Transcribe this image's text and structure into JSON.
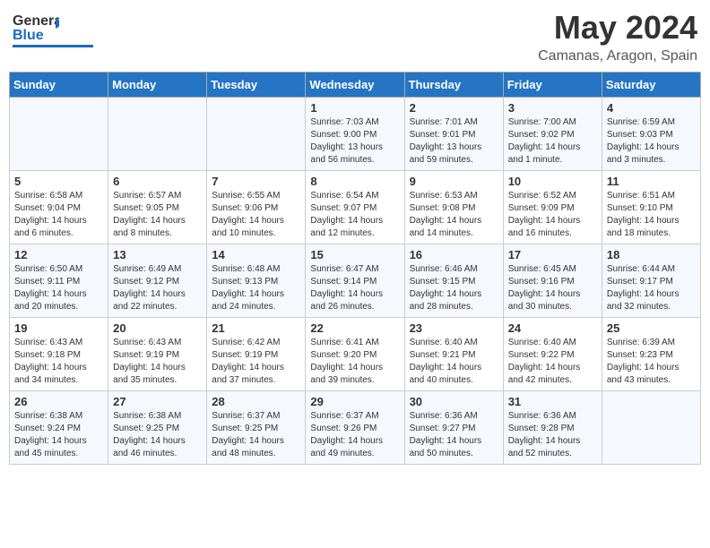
{
  "brand": {
    "name_part1": "General",
    "name_part2": "Blue"
  },
  "header": {
    "month_year": "May 2024",
    "location": "Camanas, Aragon, Spain"
  },
  "weekdays": [
    "Sunday",
    "Monday",
    "Tuesday",
    "Wednesday",
    "Thursday",
    "Friday",
    "Saturday"
  ],
  "weeks": [
    [
      {
        "day": "",
        "info": ""
      },
      {
        "day": "",
        "info": ""
      },
      {
        "day": "",
        "info": ""
      },
      {
        "day": "1",
        "info": "Sunrise: 7:03 AM\nSunset: 9:00 PM\nDaylight: 13 hours\nand 56 minutes."
      },
      {
        "day": "2",
        "info": "Sunrise: 7:01 AM\nSunset: 9:01 PM\nDaylight: 13 hours\nand 59 minutes."
      },
      {
        "day": "3",
        "info": "Sunrise: 7:00 AM\nSunset: 9:02 PM\nDaylight: 14 hours\nand 1 minute."
      },
      {
        "day": "4",
        "info": "Sunrise: 6:59 AM\nSunset: 9:03 PM\nDaylight: 14 hours\nand 3 minutes."
      }
    ],
    [
      {
        "day": "5",
        "info": "Sunrise: 6:58 AM\nSunset: 9:04 PM\nDaylight: 14 hours\nand 6 minutes."
      },
      {
        "day": "6",
        "info": "Sunrise: 6:57 AM\nSunset: 9:05 PM\nDaylight: 14 hours\nand 8 minutes."
      },
      {
        "day": "7",
        "info": "Sunrise: 6:55 AM\nSunset: 9:06 PM\nDaylight: 14 hours\nand 10 minutes."
      },
      {
        "day": "8",
        "info": "Sunrise: 6:54 AM\nSunset: 9:07 PM\nDaylight: 14 hours\nand 12 minutes."
      },
      {
        "day": "9",
        "info": "Sunrise: 6:53 AM\nSunset: 9:08 PM\nDaylight: 14 hours\nand 14 minutes."
      },
      {
        "day": "10",
        "info": "Sunrise: 6:52 AM\nSunset: 9:09 PM\nDaylight: 14 hours\nand 16 minutes."
      },
      {
        "day": "11",
        "info": "Sunrise: 6:51 AM\nSunset: 9:10 PM\nDaylight: 14 hours\nand 18 minutes."
      }
    ],
    [
      {
        "day": "12",
        "info": "Sunrise: 6:50 AM\nSunset: 9:11 PM\nDaylight: 14 hours\nand 20 minutes."
      },
      {
        "day": "13",
        "info": "Sunrise: 6:49 AM\nSunset: 9:12 PM\nDaylight: 14 hours\nand 22 minutes."
      },
      {
        "day": "14",
        "info": "Sunrise: 6:48 AM\nSunset: 9:13 PM\nDaylight: 14 hours\nand 24 minutes."
      },
      {
        "day": "15",
        "info": "Sunrise: 6:47 AM\nSunset: 9:14 PM\nDaylight: 14 hours\nand 26 minutes."
      },
      {
        "day": "16",
        "info": "Sunrise: 6:46 AM\nSunset: 9:15 PM\nDaylight: 14 hours\nand 28 minutes."
      },
      {
        "day": "17",
        "info": "Sunrise: 6:45 AM\nSunset: 9:16 PM\nDaylight: 14 hours\nand 30 minutes."
      },
      {
        "day": "18",
        "info": "Sunrise: 6:44 AM\nSunset: 9:17 PM\nDaylight: 14 hours\nand 32 minutes."
      }
    ],
    [
      {
        "day": "19",
        "info": "Sunrise: 6:43 AM\nSunset: 9:18 PM\nDaylight: 14 hours\nand 34 minutes."
      },
      {
        "day": "20",
        "info": "Sunrise: 6:43 AM\nSunset: 9:19 PM\nDaylight: 14 hours\nand 35 minutes."
      },
      {
        "day": "21",
        "info": "Sunrise: 6:42 AM\nSunset: 9:19 PM\nDaylight: 14 hours\nand 37 minutes."
      },
      {
        "day": "22",
        "info": "Sunrise: 6:41 AM\nSunset: 9:20 PM\nDaylight: 14 hours\nand 39 minutes."
      },
      {
        "day": "23",
        "info": "Sunrise: 6:40 AM\nSunset: 9:21 PM\nDaylight: 14 hours\nand 40 minutes."
      },
      {
        "day": "24",
        "info": "Sunrise: 6:40 AM\nSunset: 9:22 PM\nDaylight: 14 hours\nand 42 minutes."
      },
      {
        "day": "25",
        "info": "Sunrise: 6:39 AM\nSunset: 9:23 PM\nDaylight: 14 hours\nand 43 minutes."
      }
    ],
    [
      {
        "day": "26",
        "info": "Sunrise: 6:38 AM\nSunset: 9:24 PM\nDaylight: 14 hours\nand 45 minutes."
      },
      {
        "day": "27",
        "info": "Sunrise: 6:38 AM\nSunset: 9:25 PM\nDaylight: 14 hours\nand 46 minutes."
      },
      {
        "day": "28",
        "info": "Sunrise: 6:37 AM\nSunset: 9:25 PM\nDaylight: 14 hours\nand 48 minutes."
      },
      {
        "day": "29",
        "info": "Sunrise: 6:37 AM\nSunset: 9:26 PM\nDaylight: 14 hours\nand 49 minutes."
      },
      {
        "day": "30",
        "info": "Sunrise: 6:36 AM\nSunset: 9:27 PM\nDaylight: 14 hours\nand 50 minutes."
      },
      {
        "day": "31",
        "info": "Sunrise: 6:36 AM\nSunset: 9:28 PM\nDaylight: 14 hours\nand 52 minutes."
      },
      {
        "day": "",
        "info": ""
      }
    ]
  ]
}
